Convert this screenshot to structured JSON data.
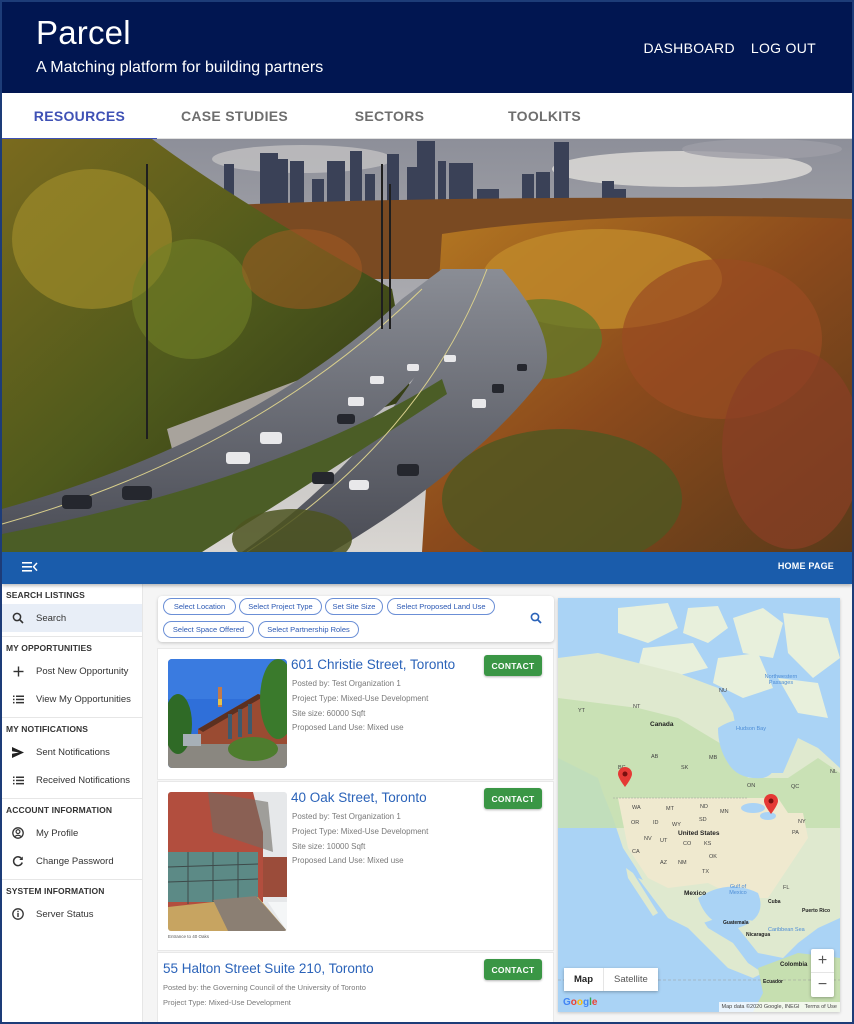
{
  "header": {
    "title": "Parcel",
    "subtitle": "A Matching platform for building partners",
    "links": [
      "DASHBOARD",
      "LOG OUT"
    ]
  },
  "tabs": [
    {
      "label": "RESOURCES",
      "active": true
    },
    {
      "label": "CASE STUDIES",
      "active": false
    },
    {
      "label": "SECTORS",
      "active": false
    },
    {
      "label": "TOOLKITS",
      "active": false
    }
  ],
  "hero": {
    "description": "Autumn highway valley with city skyline"
  },
  "appbar": {
    "menu_icon": "menu-collapse-icon",
    "home_link": "HOME PAGE"
  },
  "sidebar": {
    "sections": [
      {
        "heading": "SEARCH LISTINGS",
        "items": [
          {
            "label": "Search",
            "icon": "search-icon",
            "active": true
          }
        ]
      },
      {
        "heading": "MY OPPORTUNITIES",
        "items": [
          {
            "label": "Post New Opportunity",
            "icon": "plus-icon"
          },
          {
            "label": "View My Opportunities",
            "icon": "list-icon"
          }
        ]
      },
      {
        "heading": "MY NOTIFICATIONS",
        "items": [
          {
            "label": "Sent Notifications",
            "icon": "send-icon"
          },
          {
            "label": "Received Notifications",
            "icon": "list-icon"
          }
        ]
      },
      {
        "heading": "ACCOUNT INFORMATION",
        "items": [
          {
            "label": "My Profile",
            "icon": "account-circle-icon"
          },
          {
            "label": "Change Password",
            "icon": "refresh-icon"
          }
        ]
      },
      {
        "heading": "SYSTEM INFORMATION",
        "items": [
          {
            "label": "Server Status",
            "icon": "info-icon"
          }
        ]
      }
    ]
  },
  "filters": {
    "chips": [
      "Select Location",
      "Select Project Type",
      "Set Site Size",
      "Select Proposed Land Use",
      "Select Space Offered",
      "Select Partnership Roles"
    ],
    "search_icon": "search-icon"
  },
  "listings": [
    {
      "title": "601 Christie Street, Toronto",
      "posted_by": "Posted by: Test Organization 1",
      "project_type": "Project Type: Mixed-Use Development",
      "site_size": "Site size: 60000 Sqft",
      "land_use": "Proposed Land Use: Mixed use",
      "button": "CONTACT"
    },
    {
      "title": "40 Oak Street, Toronto",
      "posted_by": "Posted by: Test Organization 1",
      "project_type": "Project Type: Mixed-Use Development",
      "site_size": "Site size: 10000 Sqft",
      "land_use": "Proposed Land Use: Mixed use",
      "caption": "Entrance to 40 Oaks",
      "button": "CONTACT"
    },
    {
      "title": "55 Halton Street Suite 210, Toronto",
      "posted_by": "Posted by: the Governing Council of the University of Toronto",
      "project_type": "Project Type: Mixed-Use Development",
      "button": "CONTACT"
    }
  ],
  "map": {
    "type_buttons": [
      "Map",
      "Satellite"
    ],
    "selected_type": "Map",
    "zoom_in": "+",
    "zoom_out": "−",
    "logo": "Google",
    "attribution": "Map data ©2020 Google, INEGI",
    "terms": "Terms of Use",
    "labels": {
      "canada": "Canada",
      "us": "United States",
      "mexico": "Mexico",
      "hudson": "Hudson Bay",
      "northwest": "Northwestern Passages",
      "gulf": "Gulf of Mexico",
      "caribbean": "Caribbean Sea",
      "cuba": "Cuba",
      "puerto_rico": "Puerto Rico",
      "guatemala": "Guatemala",
      "nicaragua": "Nicaragua",
      "colombia": "Colombia",
      "ecuador": "Ecuador",
      "nu": "NU",
      "nt": "NT",
      "yt": "YT",
      "bc": "BC",
      "ab": "AB",
      "sk": "SK",
      "mb": "MB",
      "on": "ON",
      "qc": "QC",
      "nl": "NL",
      "wa": "WA",
      "mt": "MT",
      "nd": "ND",
      "mn": "MN",
      "or": "OR",
      "id": "ID",
      "wy": "WY",
      "sd": "SD",
      "nv": "NV",
      "ut": "UT",
      "co": "CO",
      "ks": "KS",
      "ca": "CA",
      "az": "AZ",
      "nm": "NM",
      "ok": "OK",
      "tx": "TX",
      "ny": "NY",
      "pa": "PA",
      "fl": "FL"
    },
    "pins": [
      "Vancouver",
      "Toronto"
    ]
  },
  "colors": {
    "header_bg": "#011651",
    "appbar_bg": "#1a5cab",
    "tab_active": "#3f51b5",
    "link_blue": "#2b63b9",
    "contact_green": "#3a9645",
    "pin_red": "#e53935"
  }
}
